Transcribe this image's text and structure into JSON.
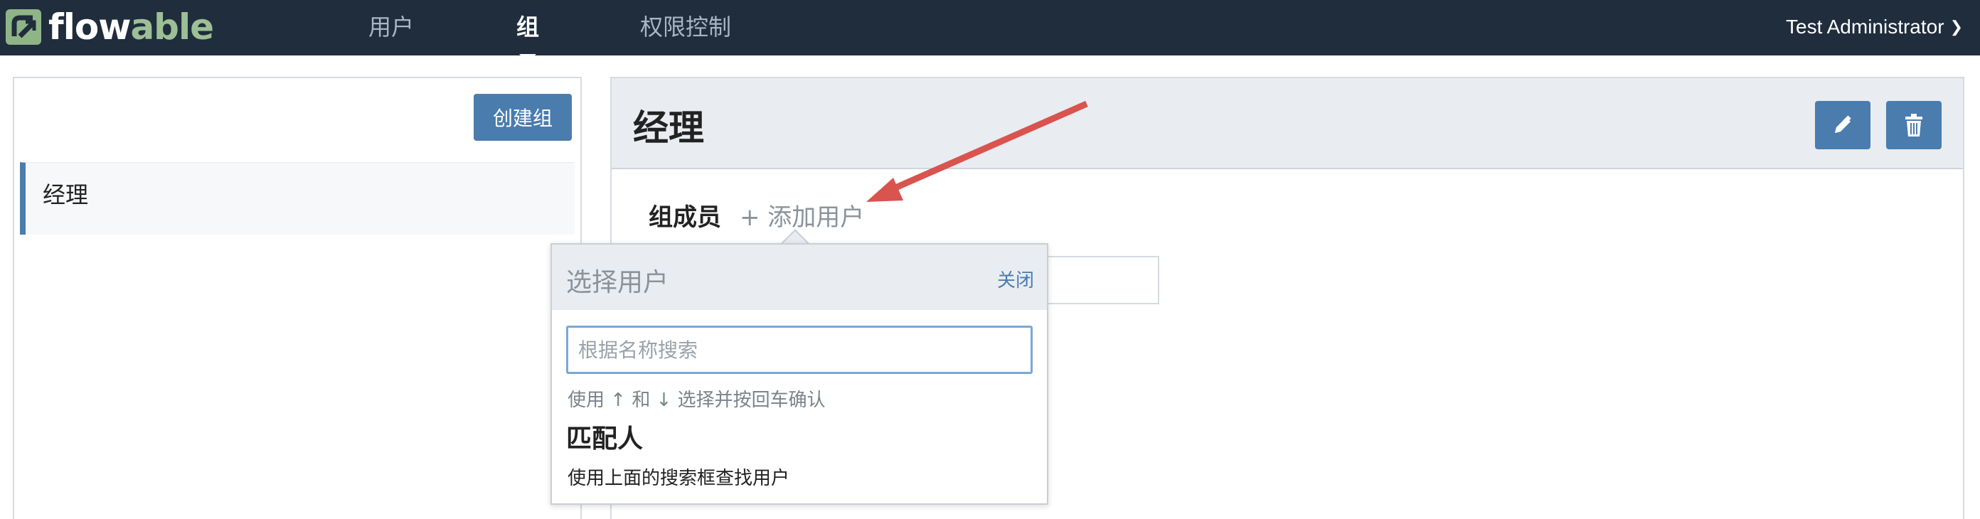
{
  "app": {
    "logo_text_main": "flow",
    "logo_text_tail": "able",
    "brand_color": "#4a7cae",
    "nav_bg_color": "#1f2d3d"
  },
  "nav": {
    "items": [
      {
        "label": "用户",
        "active": false
      },
      {
        "label": "组",
        "active": true
      },
      {
        "label": "权限控制",
        "active": false
      }
    ],
    "user_name": "Test Administrator",
    "user_chevron_icon": "chevron-down-icon"
  },
  "sidebar": {
    "create_button_label": "创建组",
    "groups": [
      {
        "label": "经理",
        "selected": true
      }
    ]
  },
  "detail": {
    "title": "经理",
    "edit_icon": "pencil-icon",
    "delete_icon": "trash-icon",
    "members_label": "组成员",
    "add_user_label": "+ 添加用户"
  },
  "popup": {
    "title": "选择用户",
    "close_label": "关闭",
    "search_placeholder": "根据名称搜索",
    "search_value": "",
    "hint": "使用 ↑ 和 ↓ 选择并按回车确认",
    "match_title": "匹配人",
    "match_desc": "使用上面的搜索框查找用户"
  },
  "annotation": {
    "arrow_color": "#d9534f"
  }
}
